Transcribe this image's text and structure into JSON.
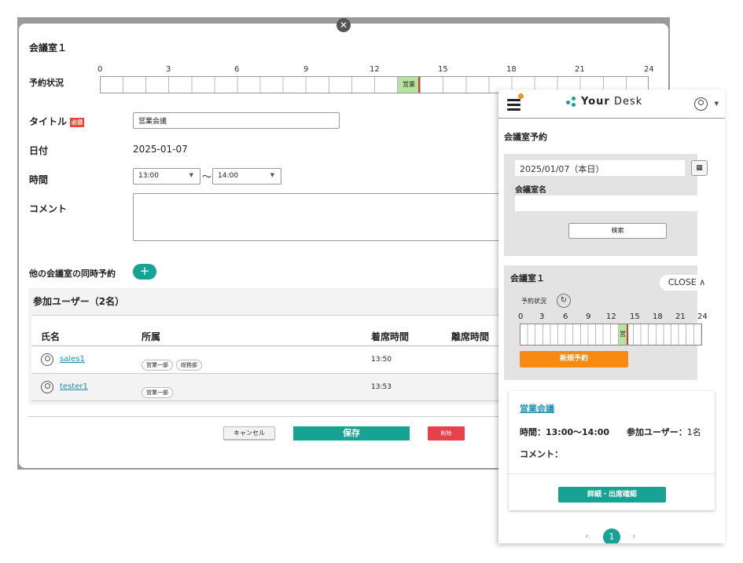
{
  "modal": {
    "room_title": "会議室１",
    "status_label": "予約状況",
    "ticks": [
      "0",
      "3",
      "6",
      "9",
      "12",
      "15",
      "18",
      "21",
      "24"
    ],
    "booking_label": "営業",
    "title_label": "タイトル",
    "required_badge": "必須",
    "title_value": "営業会議",
    "date_label": "日付",
    "date_value": "2025-01-07",
    "time_label": "時間",
    "start_time": "13:00",
    "tilde": "〜",
    "end_time": "14:00",
    "comment_label": "コメント",
    "other_rooms_label": "他の会議室の同時予約",
    "plus": "+",
    "participants_title": "参加ユーザー（2名）",
    "columns": [
      "氏名",
      "所属",
      "着席時間",
      "離席時間"
    ],
    "rows": [
      {
        "name": "sales1",
        "depts": [
          "営業一部",
          "総務部"
        ],
        "seated": "13:50"
      },
      {
        "name": "tester1",
        "depts": [
          "営業一部"
        ],
        "seated": "13:53"
      }
    ],
    "cancel": "キャンセル",
    "save": "保存",
    "delete": "削除"
  },
  "mobile": {
    "logo_bold": "Your",
    "logo_light": " Desk",
    "page_title": "会議室予約",
    "date_field": "2025/01/07（本日）",
    "room_name_label": "会議室名",
    "room_name_value": "",
    "search_button": "検索",
    "room_title": "会議室１",
    "close_button": "CLOSE",
    "status_label": "予約状況",
    "ticks": [
      "0",
      "3",
      "6",
      "9",
      "12",
      "15",
      "18",
      "21",
      "24"
    ],
    "booking_char": "営",
    "new_reservation": "新規予約",
    "card": {
      "title": "営業会議",
      "time_label": "時間：",
      "time_value": "13:00〜14:00",
      "participants_label": "参加ユーザー：",
      "participants_value": "1名",
      "comment_label": "コメント："
    },
    "detail_button": "詳細・出席確認",
    "page_prev": "‹",
    "page_current": "1",
    "page_next": "›"
  },
  "colors": {
    "accent": "#17a394",
    "orange": "#f88a13",
    "danger": "#e8414d",
    "booking": "#b6e3a0"
  }
}
